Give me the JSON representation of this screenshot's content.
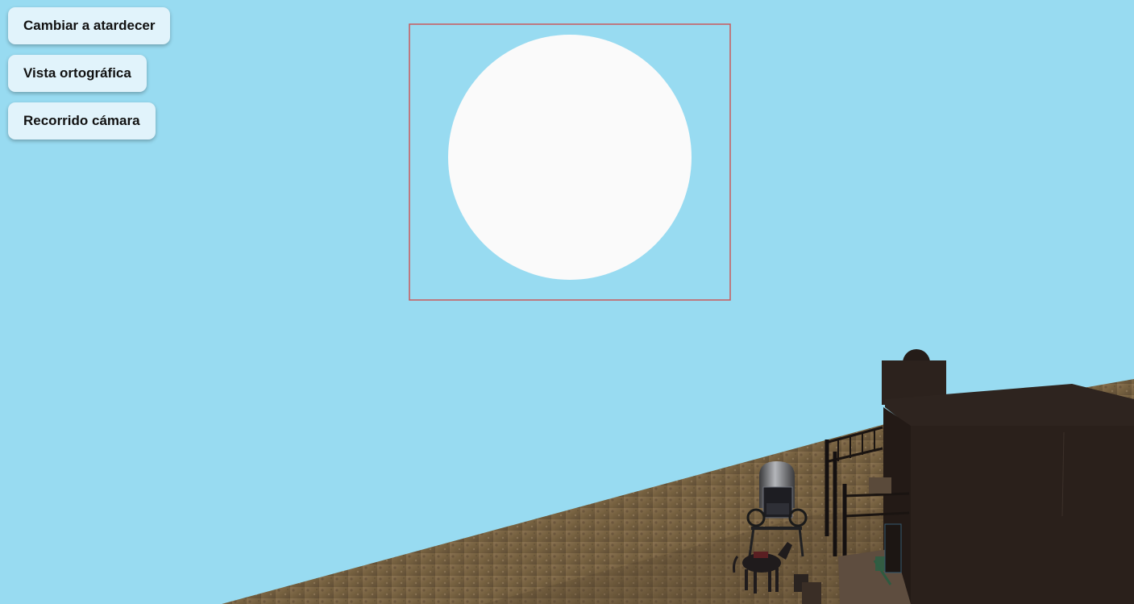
{
  "controls": {
    "buttons": [
      {
        "label": "Cambiar a atardecer"
      },
      {
        "label": "Vista ortográfica"
      },
      {
        "label": "Recorrido cámara"
      }
    ]
  },
  "scene": {
    "sky_color": "#98dbf1",
    "sun_color": "#fafafa",
    "selection_outline_color": "#c9595a",
    "ground_color": "#7a6448",
    "building_color": "#2a201b"
  }
}
